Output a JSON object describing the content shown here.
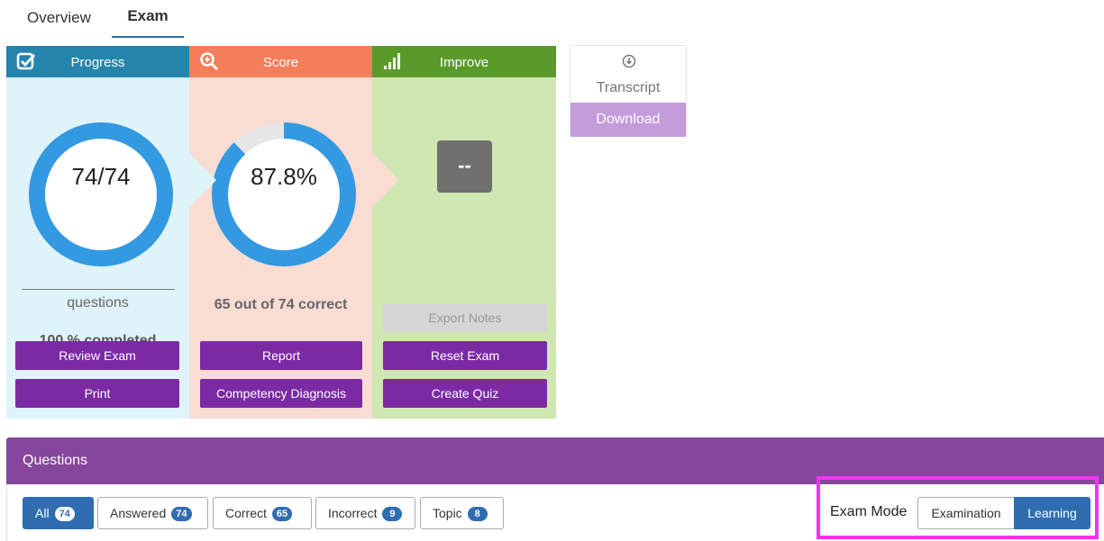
{
  "tabs": [
    {
      "label": "Overview"
    },
    {
      "label": "Exam"
    }
  ],
  "panels": {
    "progress": {
      "title": "Progress",
      "icon": "checkbox-icon",
      "color": "#2585ad",
      "donut_text": "74/74",
      "fraction": 1.0,
      "questions_label": "questions",
      "completed_label": "100 % completed",
      "buttons": [
        "Review Exam",
        "Print"
      ]
    },
    "score": {
      "title": "Score",
      "icon": "magnifier-icon",
      "color": "#f47e5a",
      "donut_text": "87.8%",
      "fraction": 0.878,
      "correct_label": "65 out of 74 correct",
      "buttons": [
        "Report",
        "Competency Diagnosis"
      ]
    },
    "improve": {
      "title": "Improve",
      "icon": "signal-bars-icon",
      "color": "#5a9a2a",
      "value": "--",
      "buttons": [
        "Export Notes",
        "Reset Exam",
        "Create Quiz"
      ]
    }
  },
  "transcript": {
    "icon": "download-circle-icon",
    "label": "Transcript",
    "download_label": "Download"
  },
  "questions": {
    "title": "Questions",
    "filters": [
      {
        "label": "All",
        "count": "74",
        "active": true
      },
      {
        "label": "Answered",
        "count": "74",
        "active": false
      },
      {
        "label": "Correct",
        "count": "65",
        "active": false
      },
      {
        "label": "Incorrect",
        "count": "9",
        "active": false
      },
      {
        "label": "Topic",
        "count": "8",
        "active": false
      }
    ],
    "mode_label": "Exam Mode",
    "modes": [
      {
        "label": "Examination",
        "active": false
      },
      {
        "label": "Learning",
        "active": true
      }
    ]
  },
  "colors": {
    "purple_button": "#7b2aa4",
    "header_purple": "#86469b",
    "donut_blue": "#3399e0",
    "accent_blue": "#2f6db0",
    "highlight_magenta": "#f233f4"
  }
}
